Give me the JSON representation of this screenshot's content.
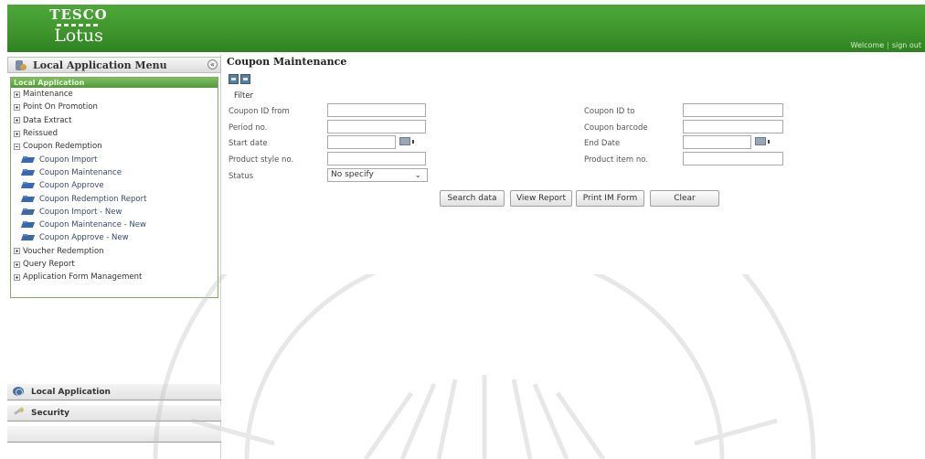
{
  "header": {
    "logo_top": "TESCO",
    "logo_bottom": "Lotus",
    "welcome": "Welcome",
    "separator": "|",
    "sign_out": "sign out"
  },
  "sidebar": {
    "title": "Local Application Menu",
    "collapse": "«",
    "tree_header": "Local Application",
    "items": [
      {
        "label": "Maintenance",
        "type": "top",
        "state": "plus"
      },
      {
        "label": "Point On Promotion",
        "type": "top",
        "state": "plus"
      },
      {
        "label": "Data Extract",
        "type": "top",
        "state": "plus"
      },
      {
        "label": "Reissued",
        "type": "top",
        "state": "plus"
      },
      {
        "label": "Coupon Redemption",
        "type": "top",
        "state": "minus"
      },
      {
        "label": "Coupon Import",
        "type": "child"
      },
      {
        "label": "Coupon Maintenance",
        "type": "child"
      },
      {
        "label": "Coupon Approve",
        "type": "child"
      },
      {
        "label": "Coupon Redemption Report",
        "type": "child"
      },
      {
        "label": "Coupon Import - New",
        "type": "child"
      },
      {
        "label": "Coupon Maintenance - New",
        "type": "child"
      },
      {
        "label": "Coupon Approve - New",
        "type": "child"
      },
      {
        "label": "Voucher Redemption",
        "type": "top",
        "state": "plus"
      },
      {
        "label": "Query Report",
        "type": "top",
        "state": "plus"
      },
      {
        "label": "Application Form Management",
        "type": "top",
        "state": "plus"
      }
    ],
    "accordion": {
      "local_application": "Local Application",
      "security": "Security"
    }
  },
  "main": {
    "title": "Coupon Maintenance",
    "filter_label": "Filter",
    "fields": {
      "coupon_id_from": "Coupon ID from",
      "coupon_id_to": "Coupon ID to",
      "period_no": "Period no.",
      "coupon_barcode": "Coupon barcode",
      "start_date": "Start date",
      "end_date": "End Date",
      "product_style_no": "Product style no.",
      "product_item_no": "Product item no.",
      "status": "Status"
    },
    "status_value": "No specify",
    "buttons": {
      "search": "Search data",
      "view_report": "View Report",
      "print": "Print IM Form",
      "clear": "Clear"
    }
  },
  "colors": {
    "header_green": "#3e962c",
    "tree_header_green": "#4f9a36",
    "folder_blue": "#3a67b5"
  }
}
